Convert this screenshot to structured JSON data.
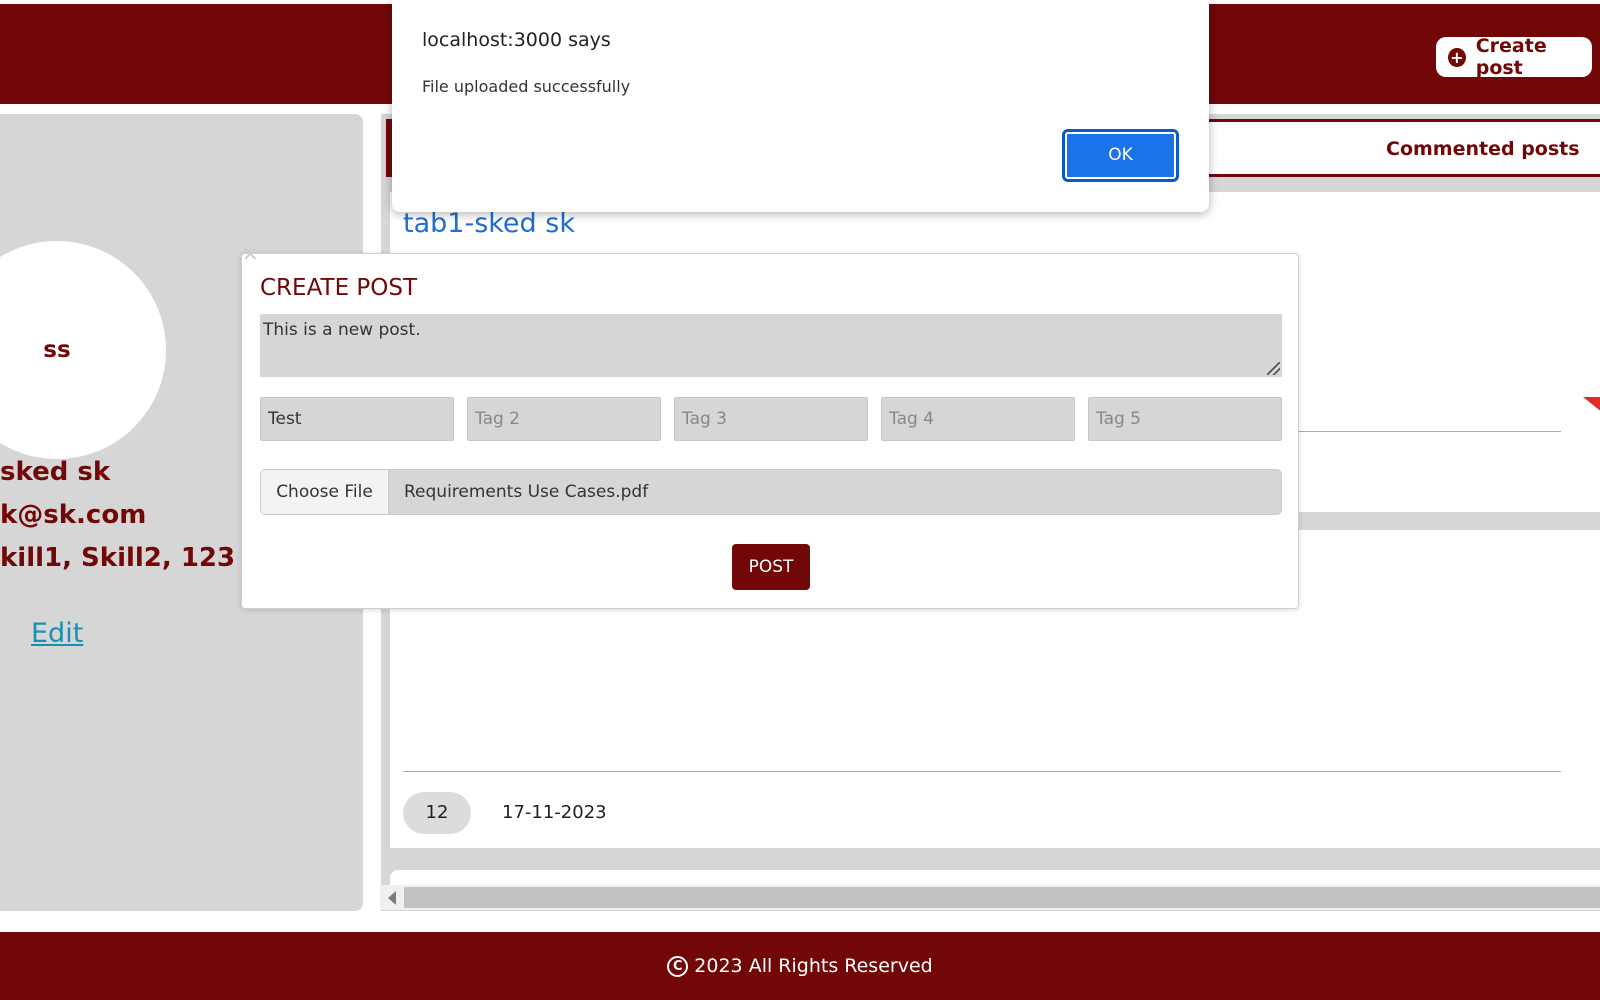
{
  "header": {
    "create_post_label": "Create post"
  },
  "profile": {
    "initials": "ss",
    "name": " sked sk",
    "email": "k@sk.com",
    "skills": "kill1, Skill2, 123",
    "edit_label": "Edit"
  },
  "tabs": {
    "commented_label": "Commented posts"
  },
  "posts": [
    {
      "title": "tab1-sked sk"
    },
    {
      "votes": "12",
      "date": "17-11-2023"
    }
  ],
  "modal": {
    "title": "CREATE POST",
    "text_value": "This is a new post.",
    "tags": [
      {
        "value": "Test",
        "placeholder": ""
      },
      {
        "value": "",
        "placeholder": "Tag 2"
      },
      {
        "value": "",
        "placeholder": "Tag 3"
      },
      {
        "value": "",
        "placeholder": "Tag 4"
      },
      {
        "value": "",
        "placeholder": "Tag 5"
      }
    ],
    "file_button": "Choose File",
    "file_name": "Requirements Use Cases.pdf",
    "post_label": "POST"
  },
  "alert": {
    "title": "localhost:3000 says",
    "message": "File uploaded successfully",
    "ok_label": "OK"
  },
  "footer": {
    "copyright_symbol": "C",
    "text": "2023 All Rights Reserved"
  },
  "colors": {
    "brand": "#720707",
    "link": "#1f6fd0",
    "ok_button": "#1a73e8"
  }
}
